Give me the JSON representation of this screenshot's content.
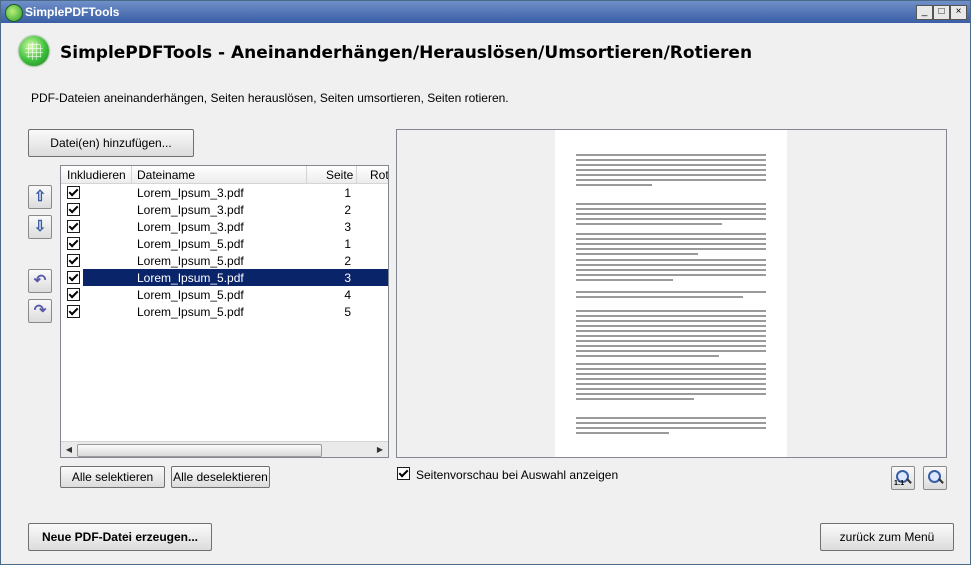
{
  "window": {
    "title": "SimplePDFTools",
    "controls": [
      "_",
      "□",
      "×"
    ]
  },
  "header": {
    "title": "SimplePDFTools - Aneinanderhängen/Herauslösen/Umsortieren/Rotieren",
    "description": "PDF-Dateien aneinanderhängen, Seiten herauslösen, Seiten umsortieren, Seiten rotieren."
  },
  "toolbar": {
    "add_files_label": "Datei(en) hinzufügen...",
    "select_all_label": "Alle selektieren",
    "deselect_all_label": "Alle deselektieren",
    "create_pdf_label": "Neue PDF-Datei erzeugen...",
    "back_label": "zurück zum Menü"
  },
  "side_buttons": [
    "arrow-up-icon",
    "arrow-down-icon",
    "rotate-left-icon",
    "rotate-right-icon"
  ],
  "table": {
    "columns": [
      "Inkludieren",
      "Dateiname",
      "Seite",
      "Rota"
    ],
    "rows": [
      {
        "included": true,
        "file": "Lorem_Ipsum_3.pdf",
        "page": "1",
        "selected": false
      },
      {
        "included": true,
        "file": "Lorem_Ipsum_3.pdf",
        "page": "2",
        "selected": false
      },
      {
        "included": true,
        "file": "Lorem_Ipsum_3.pdf",
        "page": "3",
        "selected": false
      },
      {
        "included": true,
        "file": "Lorem_Ipsum_5.pdf",
        "page": "1",
        "selected": false
      },
      {
        "included": true,
        "file": "Lorem_Ipsum_5.pdf",
        "page": "2",
        "selected": false
      },
      {
        "included": true,
        "file": "Lorem_Ipsum_5.pdf",
        "page": "3",
        "selected": true
      },
      {
        "included": true,
        "file": "Lorem_Ipsum_5.pdf",
        "page": "4",
        "selected": false
      },
      {
        "included": true,
        "file": "Lorem_Ipsum_5.pdf",
        "page": "5",
        "selected": false
      }
    ]
  },
  "preview": {
    "show_on_select_label": "Seitenvorschau bei Auswahl anzeigen",
    "show_on_select_checked": true,
    "zoom_actual_label": "1:1",
    "selected_color": "#0a246a"
  }
}
